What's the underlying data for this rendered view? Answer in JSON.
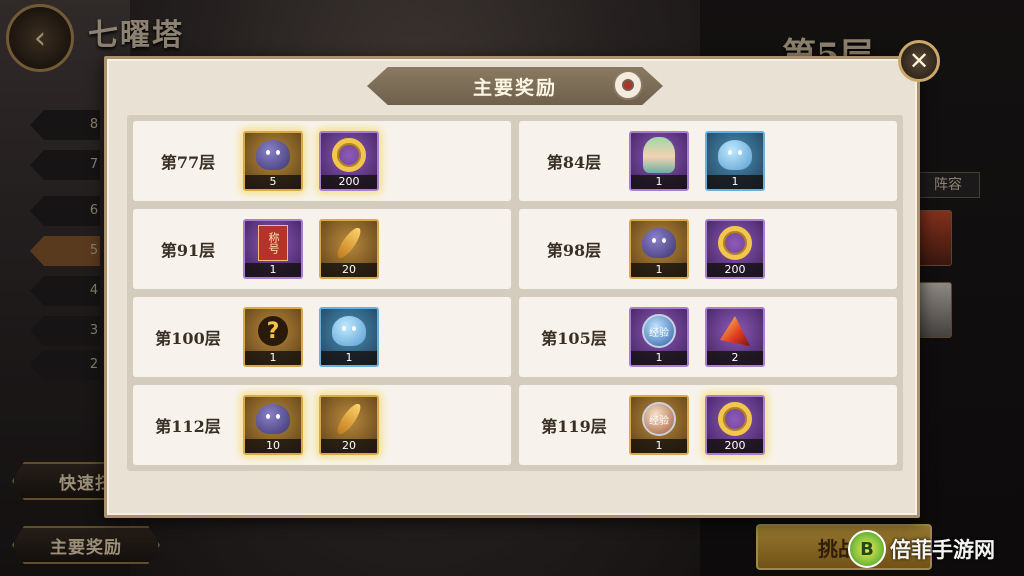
{
  "background": {
    "tower_title": "七曜塔",
    "floor_heading": "第5层",
    "floor_list": [
      "8",
      "7",
      "6",
      "5",
      "4",
      "3",
      "2"
    ],
    "active_floor": "5",
    "lineup_tab": "阵容",
    "quick_sweep_button": "快速扫",
    "main_rewards_button": "主要奖励",
    "challenge_button": "挑战",
    "watermark": "倍菲手游网"
  },
  "modal": {
    "title": "主要奖励",
    "close_icon": "close-icon",
    "rewards": [
      {
        "floor": "第77层",
        "items": [
          {
            "icon": "purple-blob",
            "rarity": "gold",
            "count": "5",
            "glow": true
          },
          {
            "icon": "gold-coin",
            "rarity": "purple",
            "count": "200",
            "glow": true
          }
        ]
      },
      {
        "floor": "第84层",
        "items": [
          {
            "icon": "hero-portrait",
            "rarity": "purple",
            "count": "1",
            "glow": false
          },
          {
            "icon": "blue-blob",
            "rarity": "blue",
            "count": "1",
            "glow": false
          }
        ]
      },
      {
        "floor": "第91层",
        "items": [
          {
            "icon": "title-scroll",
            "rarity": "purple",
            "count": "1",
            "glow": false,
            "art_text": "称号"
          },
          {
            "icon": "golden-feather",
            "rarity": "gold",
            "count": "20",
            "glow": false
          }
        ]
      },
      {
        "floor": "第98层",
        "items": [
          {
            "icon": "purple-blob",
            "rarity": "gold",
            "count": "1",
            "glow": false
          },
          {
            "icon": "gold-coin",
            "rarity": "purple",
            "count": "200",
            "glow": false
          }
        ]
      },
      {
        "floor": "第100层",
        "items": [
          {
            "icon": "mystery-hero",
            "rarity": "gold",
            "count": "1",
            "glow": false
          },
          {
            "icon": "blue-blob",
            "rarity": "blue",
            "count": "1",
            "glow": false
          }
        ]
      },
      {
        "floor": "第105层",
        "items": [
          {
            "icon": "exp-orb",
            "rarity": "purple",
            "count": "1",
            "glow": false,
            "art_text": "经验"
          },
          {
            "icon": "red-gem",
            "rarity": "purple",
            "count": "2",
            "glow": false
          }
        ]
      },
      {
        "floor": "第112层",
        "items": [
          {
            "icon": "purple-blob",
            "rarity": "gold",
            "count": "10",
            "glow": true
          },
          {
            "icon": "golden-feather",
            "rarity": "gold",
            "count": "20",
            "glow": true
          }
        ]
      },
      {
        "floor": "第119层",
        "items": [
          {
            "icon": "exp-orb-warm",
            "rarity": "gold",
            "count": "1",
            "glow": false,
            "art_text": "经验"
          },
          {
            "icon": "gold-coin",
            "rarity": "purple",
            "count": "200",
            "glow": true
          }
        ]
      }
    ]
  }
}
